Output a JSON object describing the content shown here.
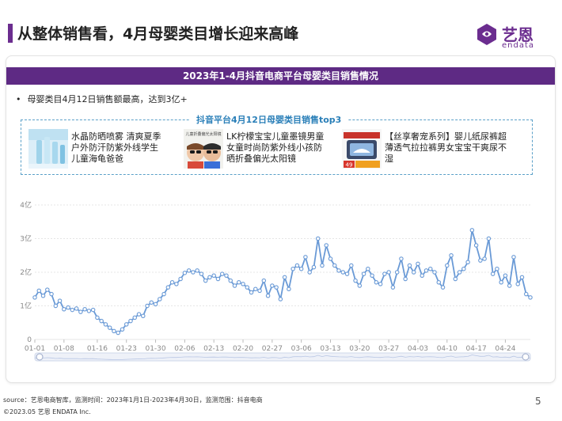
{
  "page": {
    "title": "从整体销售看，4月母婴类目增长迎来高峰",
    "page_number": "5"
  },
  "logo": {
    "name_cn": "艺恩",
    "name_en": "endata"
  },
  "panel": {
    "header": "2023年1-4月抖音电商平台母婴类目销售情况",
    "bullet": "母婴类目4月12日销售额最高，达到3亿+"
  },
  "top3": {
    "title": "抖音平台4月12日母婴类目销售top3",
    "products": [
      {
        "name": "水晶防晒喷雾 清爽夏季户外防汗防紫外线学生儿童海龟爸爸",
        "lines": [
          "水晶防晒喷雾 清爽夏季",
          "户外防汗防紫外线学生",
          "儿童海龟爸爸"
        ]
      },
      {
        "name": "LK柠檬宝宝儿童墨镜男童女童时尚防紫外线小孩防晒折叠偏光太阳镜",
        "lines": [
          "LK柠檬宝宝儿童墨镜男童",
          "女童时尚防紫外线小孩防",
          "晒折叠偏光太阳镜"
        ],
        "image_caption": "儿童折叠偏光太阳镜"
      },
      {
        "name": "【丝享奢宠系列】婴儿纸尿裤超薄透气拉拉裤男女宝宝干爽尿不湿",
        "lines": [
          "【丝享奢宠系列】婴儿纸尿裤超",
          "薄透气拉拉裤男女宝宝干爽尿不",
          "湿"
        ],
        "image_badge": "49"
      }
    ]
  },
  "colors": {
    "brand": "#6b2d8f",
    "header_bg": "#5e2a84",
    "line": "#6a9ad6",
    "frame": "#5aa0c8"
  },
  "chart_data": {
    "type": "line",
    "title": "",
    "xlabel": "",
    "ylabel": "",
    "ylim": [
      0,
      4
    ],
    "y_ticks": [
      "0",
      "1亿",
      "2亿",
      "3亿",
      "4亿"
    ],
    "x_ticks": [
      "01-01",
      "01-08",
      "01-16",
      "01-23",
      "01-30",
      "02-06",
      "02-13",
      "02-20",
      "02-27",
      "03-06",
      "03-13",
      "03-20",
      "03-27",
      "04-03",
      "04-10",
      "04-17",
      "04-24"
    ],
    "grid": true,
    "x": [
      "01-01",
      "01-02",
      "01-03",
      "01-04",
      "01-05",
      "01-06",
      "01-07",
      "01-08",
      "01-09",
      "01-10",
      "01-11",
      "01-12",
      "01-13",
      "01-14",
      "01-15",
      "01-16",
      "01-17",
      "01-18",
      "01-19",
      "01-20",
      "01-21",
      "01-22",
      "01-23",
      "01-24",
      "01-25",
      "01-26",
      "01-27",
      "01-28",
      "01-29",
      "01-30",
      "01-31",
      "02-01",
      "02-02",
      "02-03",
      "02-04",
      "02-05",
      "02-06",
      "02-07",
      "02-08",
      "02-09",
      "02-10",
      "02-11",
      "02-12",
      "02-13",
      "02-14",
      "02-15",
      "02-16",
      "02-17",
      "02-18",
      "02-19",
      "02-20",
      "02-21",
      "02-22",
      "02-23",
      "02-24",
      "02-25",
      "02-26",
      "02-27",
      "02-28",
      "03-01",
      "03-02",
      "03-03",
      "03-04",
      "03-05",
      "03-06",
      "03-07",
      "03-08",
      "03-09",
      "03-10",
      "03-11",
      "03-12",
      "03-13",
      "03-14",
      "03-15",
      "03-16",
      "03-17",
      "03-18",
      "03-19",
      "03-20",
      "03-21",
      "03-22",
      "03-23",
      "03-24",
      "03-25",
      "03-26",
      "03-27",
      "03-28",
      "03-29",
      "03-30",
      "03-31",
      "04-01",
      "04-02",
      "04-03",
      "04-04",
      "04-05",
      "04-06",
      "04-07",
      "04-08",
      "04-09",
      "04-10",
      "04-11",
      "04-12",
      "04-13",
      "04-14",
      "04-15",
      "04-16",
      "04-17",
      "04-18",
      "04-19",
      "04-20",
      "04-21",
      "04-22",
      "04-23",
      "04-24",
      "04-25",
      "04-26",
      "04-27",
      "04-28",
      "04-29",
      "04-30"
    ],
    "series": [
      {
        "values": [
          1.25,
          1.45,
          1.3,
          1.48,
          1.35,
          1.0,
          1.15,
          0.9,
          0.95,
          0.88,
          0.92,
          0.82,
          0.9,
          0.85,
          0.88,
          0.65,
          0.55,
          0.45,
          0.35,
          0.25,
          0.2,
          0.3,
          0.45,
          0.55,
          0.65,
          0.75,
          0.7,
          1.0,
          1.1,
          1.05,
          1.2,
          1.35,
          1.55,
          1.7,
          1.65,
          1.8,
          1.98,
          2.05,
          2.0,
          2.05,
          1.95,
          1.75,
          1.85,
          1.9,
          1.8,
          1.95,
          1.9,
          1.75,
          1.6,
          1.7,
          1.65,
          1.55,
          1.4,
          1.5,
          1.45,
          1.75,
          1.3,
          1.6,
          1.55,
          1.2,
          1.85,
          1.5,
          2.1,
          2.2,
          2.1,
          2.45,
          2.0,
          2.15,
          3.0,
          2.2,
          2.8,
          2.4,
          2.2,
          2.05,
          2.0,
          1.95,
          2.2,
          1.75,
          1.6,
          1.95,
          2.1,
          1.9,
          1.7,
          1.65,
          1.95,
          2.0,
          1.55,
          2.0,
          2.4,
          1.8,
          2.2,
          2.0,
          2.25,
          1.9,
          2.05,
          2.1,
          2.0,
          1.7,
          1.55,
          2.2,
          2.5,
          1.8,
          2.0,
          2.1,
          2.3,
          3.25,
          2.8,
          2.35,
          2.4,
          3.0,
          1.95,
          2.1,
          1.7,
          1.9,
          1.6,
          2.45,
          1.65,
          1.85,
          1.35,
          1.25
        ]
      }
    ]
  },
  "footer": {
    "source": "source：艺恩电商智库，监测时间：2023年1月1日-2023年4月30日，监测范围：抖音电商",
    "copyright": "©2023.05 艺恩 ENDATA Inc."
  }
}
